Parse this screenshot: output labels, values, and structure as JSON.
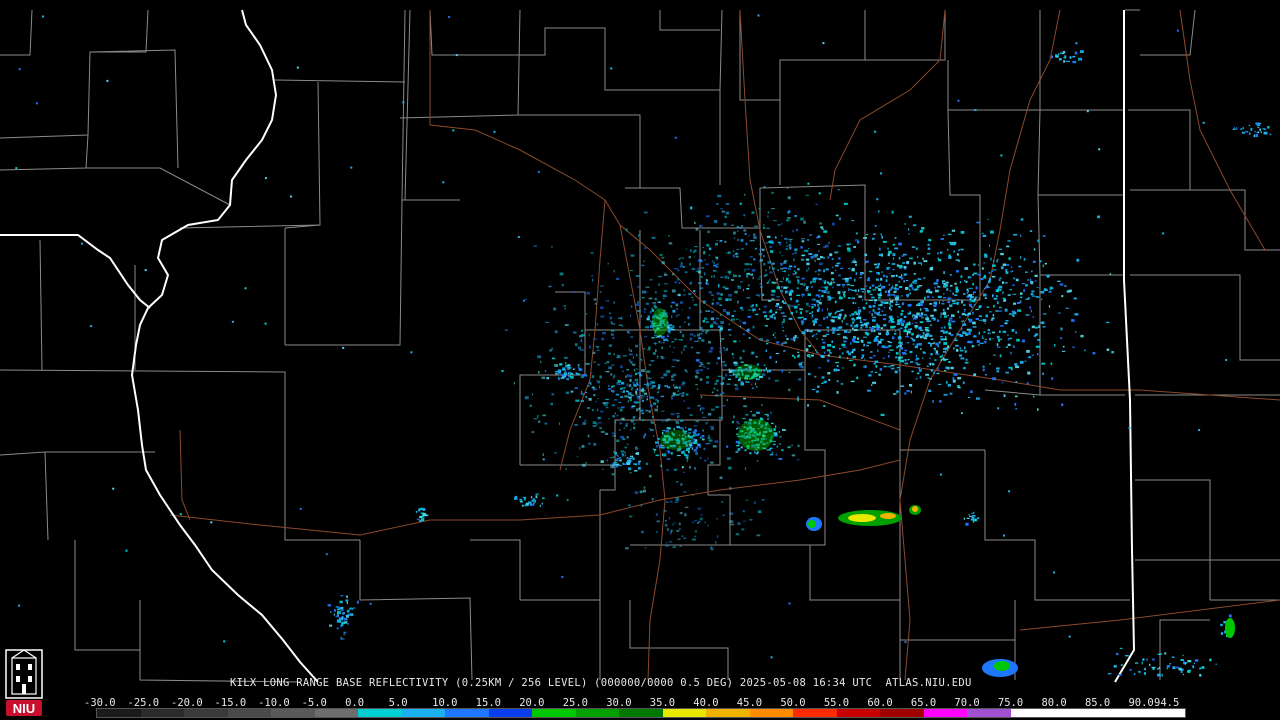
{
  "product": {
    "caption": "KILX LONG RANGE BASE REFLECTIVITY (0.25KM / 256 LEVEL) (000000/0000 0.5 DEG) 2025-05-08 16:34 UTC  ATLAS.NIU.EDU"
  },
  "logo": {
    "text": "NIU",
    "color": "#c8102e"
  },
  "legend": {
    "labels": [
      "-30.0",
      "-25.0",
      "-20.0",
      "-15.0",
      "-10.0",
      "-5.0",
      "0.0",
      "5.0",
      "10.0",
      "15.0",
      "20.0",
      "25.0",
      "30.0",
      "35.0",
      "40.0",
      "45.0",
      "50.0",
      "55.0",
      "60.0",
      "65.0",
      "70.0",
      "75.0",
      "80.0",
      "85.0",
      "90.0",
      "94.5"
    ],
    "colors": [
      "#1a1a1a",
      "#2b2b2b",
      "#3a3a3a",
      "#4a4a4a",
      "#5a5a5a",
      "#6e6e6e",
      "#00ced1",
      "#1ab0f0",
      "#1e78ff",
      "#0a3cf0",
      "#00c800",
      "#00a000",
      "#007800",
      "#e8e800",
      "#f0b400",
      "#ff8c00",
      "#ff2a00",
      "#c80000",
      "#a00000",
      "#ff00ff",
      "#a050d0",
      "#ffffff",
      "#ffffff",
      "#ffffff",
      "#ffffff"
    ]
  }
}
